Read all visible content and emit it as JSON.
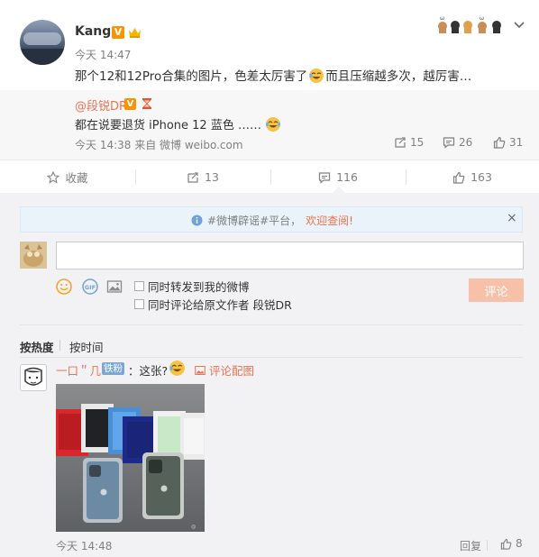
{
  "post": {
    "username": "Kang",
    "verified_badge": "V",
    "time": "今天 14:47",
    "text_part1": "那个12和12Pro合集的图片，色差太厉害了",
    "text_part2": "而且压缩越多次，越厉害…"
  },
  "repost": {
    "username": "@段锐DR",
    "verified_badge": "V",
    "text": "都在说要退货 iPhone 12 蓝色 ……",
    "meta": "今天 14:38 来自 微博 weibo.com",
    "reposts": "15",
    "comments": "26",
    "likes": "31"
  },
  "actions": {
    "favorite": "收藏",
    "repost": "13",
    "comment": "116",
    "like": "163"
  },
  "notice": {
    "prefix": "#微博辟谣#平台，",
    "link": "欢迎查阅!",
    "close": "×"
  },
  "composer": {
    "input_value": "",
    "also_repost": "同时转发到我的微博",
    "also_comment": "同时评论给原文作者 段锐DR",
    "submit": "评论"
  },
  "sort": {
    "hot": "按热度",
    "time": "按时间"
  },
  "comment": {
    "username": "一口＂几",
    "fan_badge": "铁粉",
    "text": "：这张?",
    "pic_link": "评论配图",
    "time": "今天 14:48",
    "reply": "回复",
    "likes": "8"
  },
  "colors": {
    "accent": "#eb7350",
    "muted": "#808080",
    "badge": "#f79400",
    "submit_disabled": "#f7c0a9"
  }
}
